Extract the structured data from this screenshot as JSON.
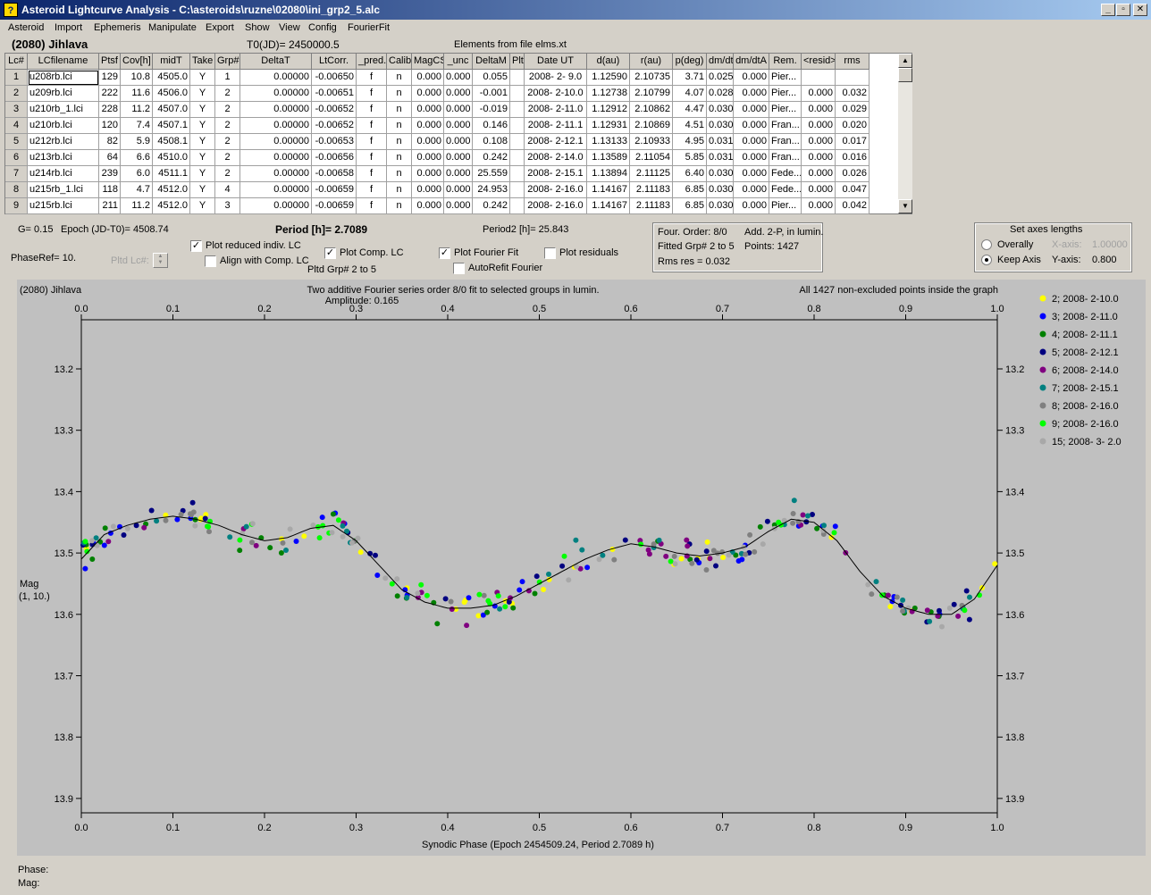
{
  "window": {
    "title": "Asteroid Lightcurve Analysis - C:\\asteroids\\ruzne\\02080\\ini_grp2_5.alc",
    "app_icon": "lightcurve-app-icon",
    "buttons": [
      "_",
      "▫",
      "✕"
    ]
  },
  "menu": [
    "Asteroid",
    "Import",
    "Ephemeris",
    "Manipulate",
    "Export",
    "Show",
    "View",
    "Config",
    "FourierFit"
  ],
  "header": {
    "object_name": "(2080) Jihlava",
    "t0": "T0(JD)= 2450000.5",
    "elements": "Elements from file elms.xt"
  },
  "table": {
    "columns": [
      "Lc#",
      "LCfilename",
      "Ptsf",
      "Cov[h]",
      "midT",
      "Take",
      "Grp#",
      "DeltaT",
      "LtCorr.",
      "_pred.",
      "Calib.",
      "MagCS",
      "_unc",
      "DeltaM",
      "Plt",
      "Date UT",
      "d(au)",
      "r(au)",
      "p(deg)",
      "dm/dt",
      "dm/dtA",
      "Rem.",
      "<resid>",
      "rms res"
    ],
    "rows": [
      [
        "1",
        "u208rb.lci",
        "129",
        "10.8",
        "4505.0",
        "Y",
        "1",
        "0.00000",
        "-0.00650",
        "f",
        "n",
        "0.000",
        "0.000",
        "0.055",
        "",
        "2008- 2- 9.0",
        "1.12590",
        "2.10735",
        "3.71",
        "0.025",
        "0.000",
        "Pier...",
        "",
        ""
      ],
      [
        "2",
        "u209rb.lci",
        "222",
        "11.6",
        "4506.0",
        "Y",
        "2",
        "0.00000",
        "-0.00651",
        "f",
        "n",
        "0.000",
        "0.000",
        "-0.001",
        "",
        "2008- 2-10.0",
        "1.12738",
        "2.10799",
        "4.07",
        "0.028",
        "0.000",
        "Pier...",
        "0.000",
        "0.032"
      ],
      [
        "3",
        "u210rb_1.lci",
        "228",
        "11.2",
        "4507.0",
        "Y",
        "2",
        "0.00000",
        "-0.00652",
        "f",
        "n",
        "0.000",
        "0.000",
        "-0.019",
        "",
        "2008- 2-11.0",
        "1.12912",
        "2.10862",
        "4.47",
        "0.030",
        "0.000",
        "Pier...",
        "0.000",
        "0.029"
      ],
      [
        "4",
        "u210rb.lci",
        "120",
        "7.4",
        "4507.1",
        "Y",
        "2",
        "0.00000",
        "-0.00652",
        "f",
        "n",
        "0.000",
        "0.000",
        "0.146",
        "",
        "2008- 2-11.1",
        "1.12931",
        "2.10869",
        "4.51",
        "0.030",
        "0.000",
        "Fran...",
        "0.000",
        "0.020"
      ],
      [
        "5",
        "u212rb.lci",
        "82",
        "5.9",
        "4508.1",
        "Y",
        "2",
        "0.00000",
        "-0.00653",
        "f",
        "n",
        "0.000",
        "0.000",
        "0.108",
        "",
        "2008- 2-12.1",
        "1.13133",
        "2.10933",
        "4.95",
        "0.031",
        "0.000",
        "Fran...",
        "0.000",
        "0.017"
      ],
      [
        "6",
        "u213rb.lci",
        "64",
        "6.6",
        "4510.0",
        "Y",
        "2",
        "0.00000",
        "-0.00656",
        "f",
        "n",
        "0.000",
        "0.000",
        "0.242",
        "",
        "2008- 2-14.0",
        "1.13589",
        "2.11054",
        "5.85",
        "0.031",
        "0.000",
        "Fran...",
        "0.000",
        "0.016"
      ],
      [
        "7",
        "u214rb.lci",
        "239",
        "6.0",
        "4511.1",
        "Y",
        "2",
        "0.00000",
        "-0.00658",
        "f",
        "n",
        "0.000",
        "0.000",
        "25.559",
        "",
        "2008- 2-15.1",
        "1.13894",
        "2.11125",
        "6.40",
        "0.030",
        "0.000",
        "Fede...",
        "0.000",
        "0.026"
      ],
      [
        "8",
        "u215rb_1.lci",
        "118",
        "4.7",
        "4512.0",
        "Y",
        "4",
        "0.00000",
        "-0.00659",
        "f",
        "n",
        "0.000",
        "0.000",
        "24.953",
        "",
        "2008- 2-16.0",
        "1.14167",
        "2.11183",
        "6.85",
        "0.030",
        "0.000",
        "Fede...",
        "0.000",
        "0.047"
      ],
      [
        "9",
        "u215rb.lci",
        "211",
        "11.2",
        "4512.0",
        "Y",
        "3",
        "0.00000",
        "-0.00659",
        "f",
        "n",
        "0.000",
        "0.000",
        "0.242",
        "",
        "2008- 2-16.0",
        "1.14167",
        "2.11183",
        "6.85",
        "0.030",
        "0.000",
        "Pier...",
        "0.000",
        "0.042"
      ]
    ],
    "scroll_up": "▲",
    "scroll_down": "▼"
  },
  "info": {
    "g": "G= 0.15",
    "epoch": "Epoch (JD-T0)= 4508.74",
    "period": "Period [h]= 2.7089",
    "period2": "Period2 [h]= 25.843",
    "phaseref": "PhaseRef= 10.",
    "pltd_lc": "Pltd Lc#:",
    "pltd_grp": "Pltd Grp#  2   to   5"
  },
  "checkboxes": {
    "plot_reduced": {
      "label": "Plot reduced indiv. LC",
      "checked": true
    },
    "align_comp": {
      "label": "Align with Comp. LC",
      "checked": false
    },
    "plot_comp": {
      "label": "Plot Comp. LC",
      "checked": true
    },
    "plot_fourier": {
      "label": "Plot Fourier Fit",
      "checked": true
    },
    "autorefit": {
      "label": "AutoRefit Fourier",
      "checked": false
    },
    "plot_residuals": {
      "label": "Plot residuals",
      "checked": false
    }
  },
  "fourier_info": {
    "order": "Four. Order:  8/0",
    "add": "Add. 2-P, in lumin.",
    "fitted": "Fitted Grp# 2 to 5",
    "points": "Points: 1427",
    "rms": "Rms res     = 0.032"
  },
  "axes_box": {
    "title": "Set axes lengths",
    "overally": "Overally",
    "keep_axis": "Keep Axis",
    "selected": "Keep Axis",
    "x_axis_label": "X-axis:",
    "x_axis_value": "1.00000",
    "y_axis_label": "Y-axis:",
    "y_axis_value": "0.800"
  },
  "plot": {
    "corner_label": "(2080) Jihlava",
    "header_line1": "Two additive Fourier series order 8/0 fit to selected groups in lumin.",
    "header_line2": "Amplitude: 0.165",
    "points_note": "All 1427 non-excluded points inside the graph",
    "y_label1": "Mag",
    "y_label2": "(1, 10.)"
  },
  "chart_data": {
    "type": "scatter",
    "title": "Two additive Fourier series order 8/0 fit to selected groups in lumin.",
    "xlabel": "Synodic Phase (Epoch 2454509.24, Period 2.7089 h)",
    "ylabel": "Mag",
    "xlim": [
      0.0,
      1.0
    ],
    "ylim": [
      13.9,
      13.2
    ],
    "y_inverted": true,
    "x_ticks": [
      "0.0",
      "0.1",
      "0.2",
      "0.3",
      "0.4",
      "0.5",
      "0.6",
      "0.7",
      "0.8",
      "0.9",
      "1.0"
    ],
    "y_ticks": [
      "13.2",
      "13.3",
      "13.4",
      "13.5",
      "13.6",
      "13.7",
      "13.8",
      "13.9"
    ],
    "grid": false,
    "legend_position": "right",
    "fourier_fit": {
      "x": [
        0.0,
        0.025,
        0.05,
        0.075,
        0.1,
        0.125,
        0.15,
        0.175,
        0.2,
        0.225,
        0.25,
        0.275,
        0.3,
        0.325,
        0.35,
        0.375,
        0.4,
        0.425,
        0.45,
        0.475,
        0.5,
        0.525,
        0.55,
        0.575,
        0.6,
        0.625,
        0.65,
        0.675,
        0.7,
        0.725,
        0.75,
        0.775,
        0.8,
        0.825,
        0.85,
        0.875,
        0.9,
        0.925,
        0.95,
        0.975,
        1.0
      ],
      "y": [
        13.51,
        13.47,
        13.455,
        13.445,
        13.44,
        13.445,
        13.455,
        13.47,
        13.48,
        13.475,
        13.46,
        13.455,
        13.48,
        13.52,
        13.56,
        13.58,
        13.59,
        13.59,
        13.585,
        13.57,
        13.55,
        13.53,
        13.51,
        13.495,
        13.485,
        13.49,
        13.5,
        13.505,
        13.5,
        13.49,
        13.465,
        13.445,
        13.45,
        13.48,
        13.53,
        13.57,
        13.59,
        13.6,
        13.6,
        13.575,
        13.52
      ],
      "color": "#000000"
    },
    "series": [
      {
        "name": "2; 2008- 2-10.0",
        "color": "#ffff00"
      },
      {
        "name": "3; 2008- 2-11.0",
        "color": "#0000ff"
      },
      {
        "name": "4; 2008- 2-11.1",
        "color": "#008000"
      },
      {
        "name": "5; 2008- 2-12.1",
        "color": "#000080"
      },
      {
        "name": "6; 2008- 2-14.0",
        "color": "#800080"
      },
      {
        "name": "7; 2008- 2-15.1",
        "color": "#008080"
      },
      {
        "name": "8; 2008- 2-16.0",
        "color": "#808080"
      },
      {
        "name": "9; 2008- 2-16.0",
        "color": "#00ff00"
      },
      {
        "name": "15; 2008- 3- 2.0",
        "color": "#a8a8a8"
      }
    ],
    "points_per_series": 30,
    "scatter_sigma": 0.03
  },
  "status": {
    "phase": "Phase:",
    "mag": "Mag:"
  }
}
